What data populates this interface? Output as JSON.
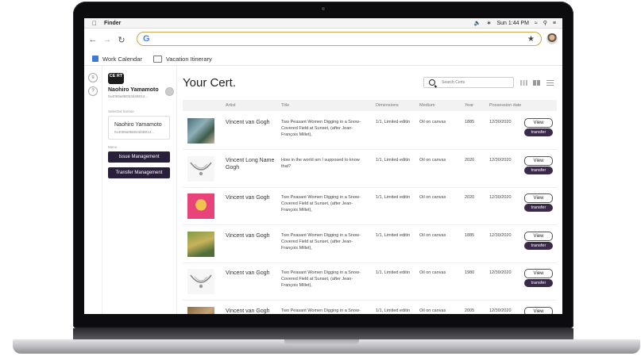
{
  "menubar": {
    "app": "Finder",
    "time": "Sun 1:44 PM"
  },
  "bookmarks": [
    "Work Calendar",
    "Vacation Itinerary"
  ],
  "sidebar": {
    "logo": "CE RT",
    "user_name": "Naohiro Yamamoto",
    "user_address": "0x4069a95EB3d4B014...",
    "selected_label": "Selected license",
    "selected_name": "Naohiro Yamamoto",
    "selected_address": "0x4069a95EB3d4B014...",
    "menu_label": "Menu",
    "menu": [
      "Issue Management",
      "Transfer Management"
    ]
  },
  "main": {
    "title": "Your Cert.",
    "search_placeholder": "Search Certs",
    "columns": [
      "Artist",
      "Title",
      "Dimensions",
      "Medium",
      "Year",
      "Possession date"
    ],
    "view_label": "View",
    "transfer_label": "transfer",
    "rows": [
      {
        "artist": "Vincent van Gogh",
        "title": "Two Peasant Women Digging in a Snow-Covered Field at Sunset, (after Jean-François Millet),",
        "dimensions": "1/1, Limited editin",
        "medium": "Oil on canvas",
        "year": "1885",
        "date": "12/30/2020",
        "thumb": "painting-blue"
      },
      {
        "artist": "Vincent  Long Name Gogh",
        "title": "How in the world am I supposed to know that?",
        "dimensions": "1/1, Limited editin",
        "medium": "Oil on canvas",
        "year": "2020",
        "date": "12/30/2020",
        "thumb": "necklace"
      },
      {
        "artist": "Vincent van Gogh",
        "title": "Two Peasant Women Digging in a Snow-Covered Field at Sunset, (after Jean-François Millet),",
        "dimensions": "1/1, Limited editin",
        "medium": "Oil on canvas",
        "year": "2020",
        "date": "12/30/2020",
        "thumb": "pop-portrait"
      },
      {
        "artist": "Vincent van Gogh",
        "title": "Two Peasant Women Digging in a Snow-Covered Field at Sunset, (after Jean-François Millet),",
        "dimensions": "1/1, Limited editin",
        "medium": "Oil on canvas",
        "year": "1885",
        "date": "12/30/2020",
        "thumb": "painting-green"
      },
      {
        "artist": "Vincent van Gogh",
        "title": "Two Peasant Women Digging in a Snow-Covered Field at Sunset, (after Jean-François Millet),",
        "dimensions": "1/1, Limited editin",
        "medium": "Oil on canvas",
        "year": "1980",
        "date": "12/30/2020",
        "thumb": "necklace"
      },
      {
        "artist": "Vincent van Gogh",
        "title": "Two Peasant Women Digging in a Snow-Covered Field at Sunset, (after",
        "dimensions": "1/1, Limited editin",
        "medium": "Oil on canvas collage",
        "year": "2005",
        "date": "12/30/2020",
        "thumb": "painting-brown"
      }
    ]
  },
  "colors": {
    "accent": "#2a1f3a",
    "transfer": "#3a2a4a",
    "omnibox_border": "#c9a84e"
  }
}
